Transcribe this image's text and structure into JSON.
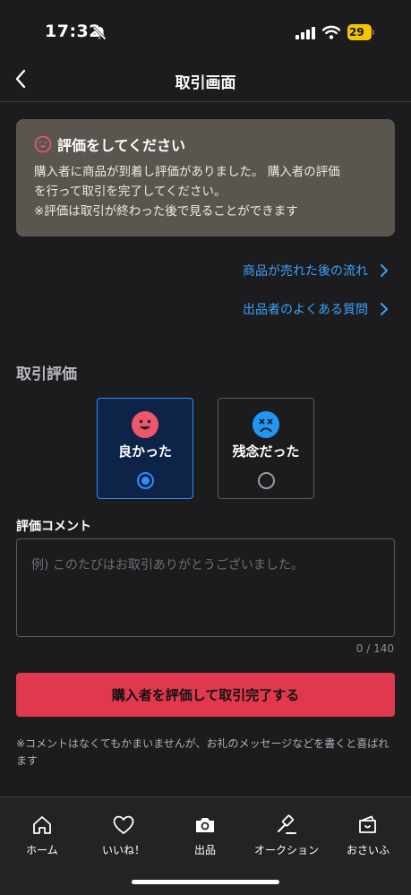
{
  "status_bar": {
    "time": "17:32",
    "battery": "29"
  },
  "nav": {
    "title": "取引画面"
  },
  "notice": {
    "title": "評価をしてください",
    "line1": "購入者に商品が到着し評価がありました。 購入者の評価",
    "line2": "を行って取引を完了してください。",
    "line3": "※評価は取引が終わった後で見ることができます"
  },
  "links": [
    {
      "label": "商品が売れた後の流れ"
    },
    {
      "label": "出品者のよくある質問"
    }
  ],
  "rating": {
    "section_title": "取引評価",
    "options": [
      {
        "label": "良かった",
        "selected": true
      },
      {
        "label": "残念だった",
        "selected": false
      }
    ]
  },
  "comment": {
    "label": "評価コメント",
    "placeholder": "例) このたびはお取引ありがとうございました。",
    "value": "",
    "count": "0 / 140"
  },
  "submit": {
    "label": "購入者を評価して取引完了する"
  },
  "footnote": "※コメントはなくてもかまいませんが、お礼のメッセージなどを書くと喜ばれます",
  "tabs": [
    {
      "label": "ホーム",
      "icon": "home-icon"
    },
    {
      "label": "いいね！",
      "icon": "heart-icon"
    },
    {
      "label": "出品",
      "icon": "camera-icon"
    },
    {
      "label": "オークション",
      "icon": "gavel-icon"
    },
    {
      "label": "おさいふ",
      "icon": "wallet-icon"
    }
  ],
  "colors": {
    "accent_blue": "#2d8cff",
    "link_blue": "#3aa3ff",
    "primary_red": "#e0384e",
    "happy_face": "#f0566b",
    "sad_face": "#2196f3",
    "battery_yellow": "#f5c400"
  }
}
